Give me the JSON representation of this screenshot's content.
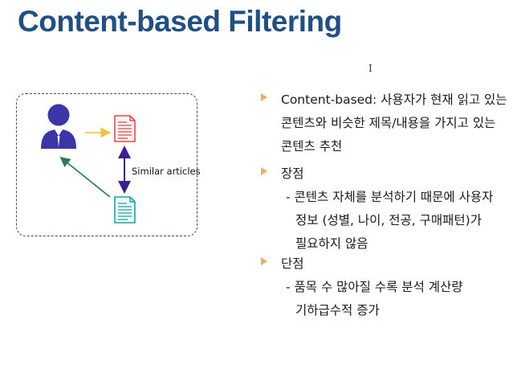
{
  "slide": {
    "title": "Content-based Filtering",
    "cursor_glyph": "I"
  },
  "diagram": {
    "similar_label": "Similar articles",
    "colors": {
      "user": "#3b35a8",
      "article_red": "#e04a4a",
      "article_teal": "#1aa3a0",
      "arrow_yellow": "#f2c23a",
      "arrow_purple": "#3b1e8f",
      "arrow_green": "#2a7a4d"
    },
    "icons": [
      "user-icon",
      "document-icon"
    ]
  },
  "bullets": [
    {
      "lines": [
        "Content-based: 사용자가 현재 읽고 있는",
        "콘텐츠와 비슷한 제목/내용을 가지고 있는",
        "콘텐츠 추천"
      ]
    },
    {
      "heading": "장점",
      "sub_lines": [
        "- 콘텐츠 자체를 분석하기 때문에 사용자",
        "정보 (성별, 나이, 전공, 구매패턴)가",
        "필요하지 않음"
      ]
    },
    {
      "heading": "단점",
      "sub_lines": [
        "- 품목 수 많아질 수록 분석 계산량",
        "기하급수적 증가"
      ]
    }
  ],
  "accent_colors": {
    "title": "#1f4f85",
    "bullet_marker": "#e4b15e"
  }
}
